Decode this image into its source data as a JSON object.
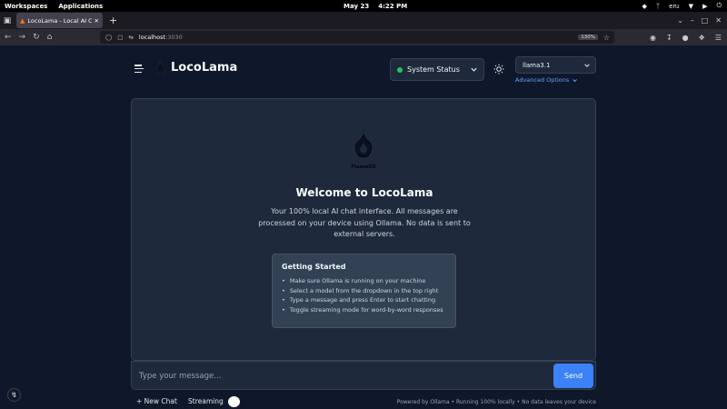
{
  "os": {
    "workspaces": "Workspaces",
    "applications": "Applications",
    "date": "May 23",
    "time": "4:22 PM",
    "lang": "en₂"
  },
  "browser": {
    "tab_title": "LocoLama - Local AI Chat En",
    "url_host": "localhost",
    "url_port": ":3030",
    "zoom": "130%"
  },
  "app": {
    "title": "LocoLama",
    "status_label": "System Status",
    "status_color": "#22c55e",
    "model": "llama3.1",
    "advanced_options": "Advanced Options"
  },
  "welcome": {
    "logo_text": "FlameOS",
    "title": "Welcome to LocoLama",
    "description": "Your 100% local AI chat interface. All messages are processed on your device using Ollama. No data is sent to external servers."
  },
  "getting_started": {
    "title": "Getting Started",
    "items": [
      "Make sure Ollama is running on your machine",
      "Select a model from the dropdown in the top right",
      "Type a message and press Enter to start chatting",
      "Toggle streaming mode for word-by-word responses"
    ]
  },
  "composer": {
    "placeholder": "Type your message...",
    "send_label": "Send"
  },
  "footer": {
    "new_chat": "+ New Chat",
    "streaming": "Streaming",
    "note": "Powered by Ollama • Running 100% locally • No data leaves your device"
  },
  "colors": {
    "background": "#0f172a",
    "panel": "#1e293b",
    "accent": "#3b82f6",
    "link": "#60a5fa"
  }
}
